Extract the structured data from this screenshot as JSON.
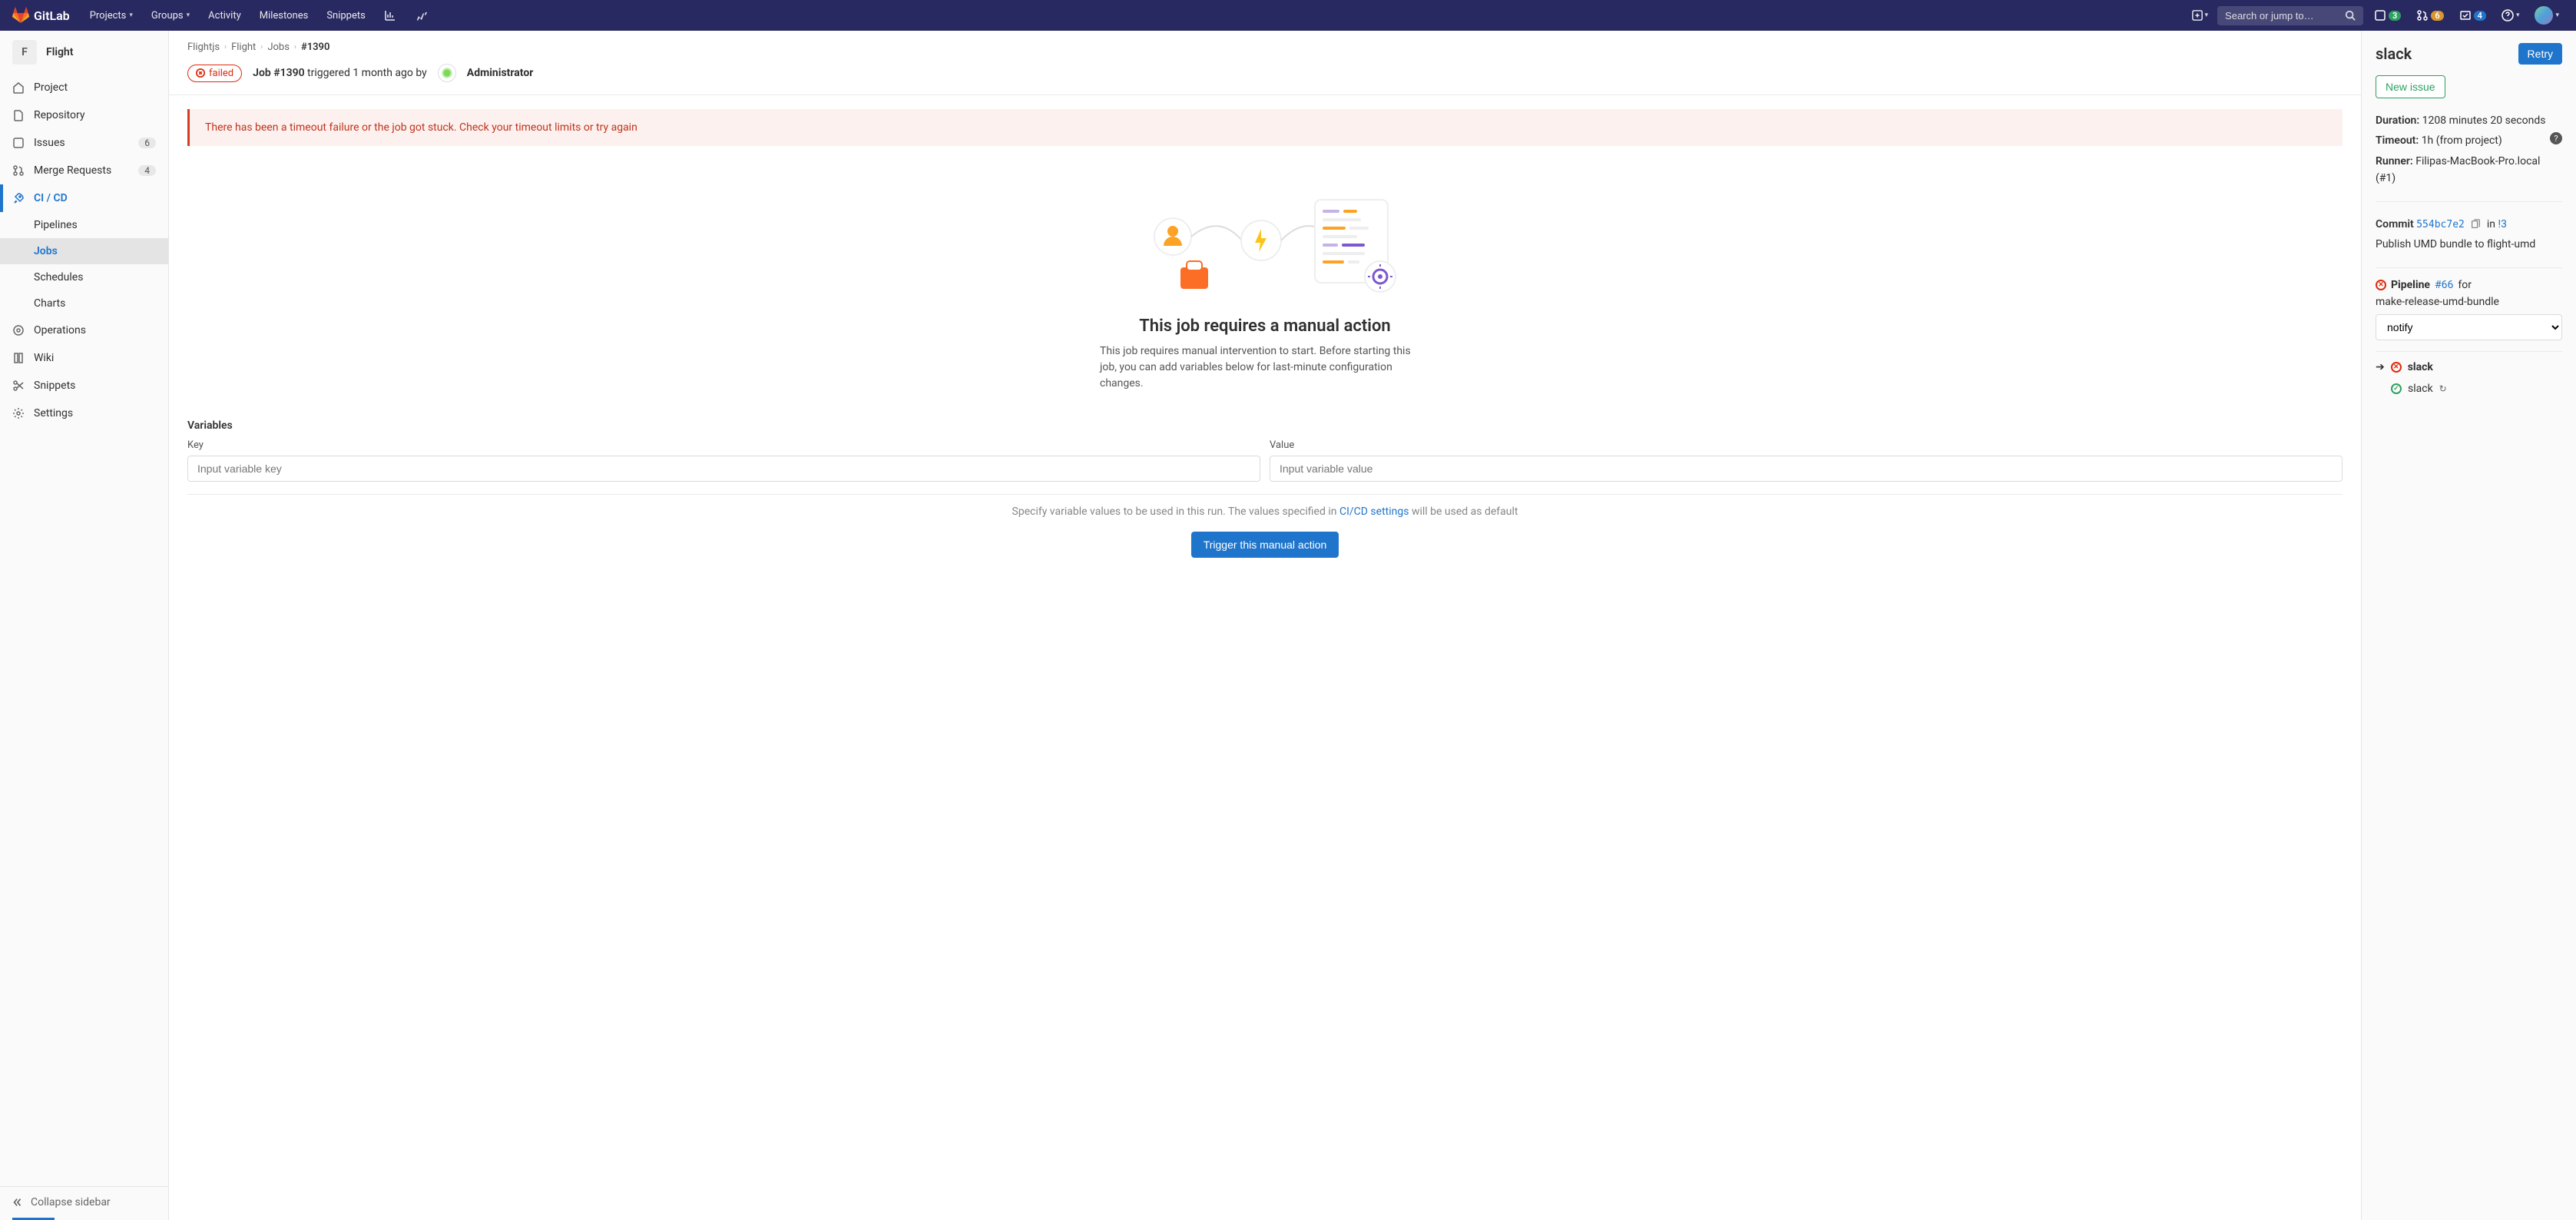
{
  "navbar": {
    "brand": "GitLab",
    "projects": "Projects",
    "groups": "Groups",
    "activity": "Activity",
    "milestones": "Milestones",
    "snippets": "Snippets",
    "search_placeholder": "Search or jump to…",
    "issues_count": "3",
    "mrs_count": "6",
    "todos_count": "4"
  },
  "project": {
    "initial": "F",
    "name": "Flight"
  },
  "sidebar": {
    "project": "Project",
    "repository": "Repository",
    "issues": "Issues",
    "issues_count": "6",
    "mrs": "Merge Requests",
    "mrs_count": "4",
    "cicd": "CI / CD",
    "pipelines": "Pipelines",
    "jobs": "Jobs",
    "schedules": "Schedules",
    "charts": "Charts",
    "operations": "Operations",
    "wiki": "Wiki",
    "snippets": "Snippets",
    "settings": "Settings",
    "collapse": "Collapse sidebar"
  },
  "breadcrumb": {
    "group": "Flightjs",
    "project": "Flight",
    "jobs": "Jobs",
    "current": "#1390"
  },
  "header": {
    "status": "failed",
    "job_prefix": "Job #1390",
    "triggered": " triggered 1 month ago by",
    "author": "Administrator"
  },
  "alert": "There has been a timeout failure or the job got stuck. Check your timeout limits or try again",
  "empty": {
    "title": "This job requires a manual action",
    "desc": "This job requires manual intervention to start. Before starting this job, you can add variables below for last-minute configuration changes."
  },
  "variables": {
    "heading": "Variables",
    "key_label": "Key",
    "value_label": "Value",
    "key_placeholder": "Input variable key",
    "value_placeholder": "Input variable value",
    "hint_before": "Specify variable values to be used in this run. The values specified in ",
    "hint_link": "CI/CD settings",
    "hint_after": " will be used as default",
    "trigger_button": "Trigger this manual action"
  },
  "right": {
    "title": "slack",
    "retry": "Retry",
    "new_issue": "New issue",
    "duration_label": "Duration:",
    "duration_value": "1208 minutes 20 seconds",
    "timeout_label": "Timeout:",
    "timeout_value": "1h (from project)",
    "runner_label": "Runner:",
    "runner_value": "Filipas-MacBook-Pro.local (#1)",
    "commit_label": "Commit",
    "commit_sha": "554bc7e2",
    "commit_in": "in",
    "commit_mr": "!3",
    "commit_msg": "Publish UMD bundle to flight-umd",
    "pipeline_label": "Pipeline",
    "pipeline_id": "#66",
    "pipeline_for": "for",
    "pipeline_branch": "make-release-umd-bundle",
    "stage_selected": "notify",
    "current_job": "slack",
    "related_job": "slack"
  }
}
